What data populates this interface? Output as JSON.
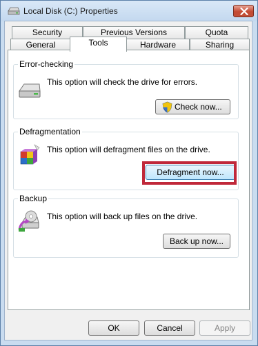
{
  "window": {
    "title": "Local Disk (C:) Properties",
    "close_label": "✕"
  },
  "tabs_row1": [
    {
      "label": "Security"
    },
    {
      "label": "Previous Versions"
    },
    {
      "label": "Quota"
    }
  ],
  "tabs_row2": [
    {
      "label": "General"
    },
    {
      "label": "Tools",
      "active": true
    },
    {
      "label": "Hardware"
    },
    {
      "label": "Sharing"
    }
  ],
  "error_checking": {
    "title": "Error-checking",
    "description": "This option will check the drive for errors.",
    "button_label": "Check now..."
  },
  "defragmentation": {
    "title": "Defragmentation",
    "description": "This option will defragment files on the drive.",
    "button_label": "Defragment now..."
  },
  "backup": {
    "title": "Backup",
    "description": "This option will back up files on the drive.",
    "button_label": "Back up now..."
  },
  "footer": {
    "ok_label": "OK",
    "cancel_label": "Cancel",
    "apply_label": "Apply"
  },
  "colors": {
    "highlight_box": "#c0283a",
    "close_button": "#c44a33",
    "window_frame": "#c9dcf0"
  },
  "icons": {
    "title": "drive-icon",
    "error_checking": "hard-drive-icon",
    "defragmentation": "defrag-icon",
    "backup": "backup-icon",
    "check_button": "shield-icon"
  }
}
